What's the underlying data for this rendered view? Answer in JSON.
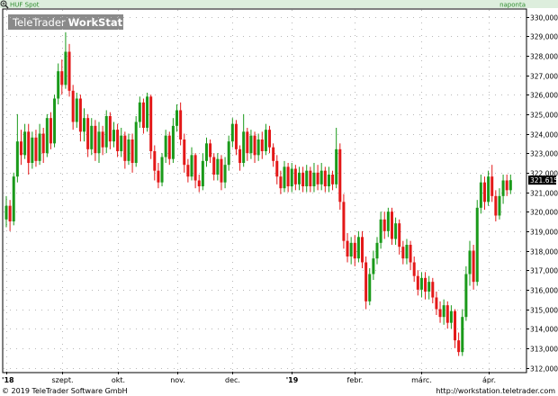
{
  "header": {
    "instrument": "HUF Spot",
    "period": "naponta",
    "watermark_prefix": "TeleTrader",
    "watermark_suffix": "WorkStation"
  },
  "footer": {
    "copyright": "© 2019 TeleTrader Software GmbH",
    "url": "http://workstation.teletrader.com"
  },
  "last_price_label": "321.6152",
  "colors": {
    "up": "#1a9a1a",
    "down": "#e31818",
    "grid": "#b9b9b9",
    "axis": "#000000",
    "bar_bg": "#ddeedd",
    "header_text": "#2e8b2e",
    "watermark_bg": "#8a8a8a"
  },
  "chart_data": {
    "type": "candlestick",
    "title": "HUF Spot",
    "interval": "naponta",
    "ylim": [
      312,
      330
    ],
    "ytick_values": [
      312,
      313,
      314,
      315,
      316,
      317,
      318,
      319,
      320,
      321,
      322,
      323,
      324,
      325,
      326,
      327,
      328,
      329,
      330
    ],
    "ytick_labels": [
      "312,000",
      "313,000",
      "314,000",
      "315,000",
      "316,000",
      "317,000",
      "318,000",
      "319,000",
      "320,000",
      "321,000",
      "322,000",
      "323,000",
      "324,000",
      "325,000",
      "326,000",
      "327,000",
      "328,000",
      "329,000",
      "330,000"
    ],
    "x_labels": [
      "'18",
      "szept.",
      "okt.",
      "nov.",
      "dec.",
      "'19",
      "febr.",
      "márc.",
      "ápr."
    ],
    "x_label_positions_day": [
      0,
      15,
      30,
      46,
      61,
      77,
      94,
      112,
      130
    ],
    "day_count": 139,
    "last_value": 321.6152,
    "grid": true,
    "candles": [
      {
        "x": 0,
        "o": 319.6,
        "c": 320.3,
        "h": 320.8,
        "l": 319.2
      },
      {
        "x": 1,
        "o": 320.3,
        "c": 319.5,
        "h": 320.6,
        "l": 319.0
      },
      {
        "x": 2,
        "o": 319.5,
        "c": 321.8,
        "h": 322.0,
        "l": 319.3
      },
      {
        "x": 3,
        "o": 321.8,
        "c": 323.6,
        "h": 325.0,
        "l": 321.5
      },
      {
        "x": 4,
        "o": 323.6,
        "c": 322.9,
        "h": 324.2,
        "l": 322.4
      },
      {
        "x": 5,
        "o": 322.9,
        "c": 324.1,
        "h": 324.5,
        "l": 322.7
      },
      {
        "x": 6,
        "o": 324.1,
        "c": 322.5,
        "h": 324.5,
        "l": 321.9
      },
      {
        "x": 7,
        "o": 322.5,
        "c": 323.8,
        "h": 324.1,
        "l": 322.2
      },
      {
        "x": 8,
        "o": 323.8,
        "c": 322.6,
        "h": 324.2,
        "l": 322.3
      },
      {
        "x": 9,
        "o": 322.6,
        "c": 324.0,
        "h": 324.5,
        "l": 322.4
      },
      {
        "x": 10,
        "o": 324.0,
        "c": 323.0,
        "h": 324.3,
        "l": 322.5
      },
      {
        "x": 11,
        "o": 323.0,
        "c": 324.8,
        "h": 325.0,
        "l": 322.8
      },
      {
        "x": 12,
        "o": 324.8,
        "c": 323.5,
        "h": 325.1,
        "l": 323.2
      },
      {
        "x": 13,
        "o": 323.5,
        "c": 325.8,
        "h": 326.0,
        "l": 323.3
      },
      {
        "x": 14,
        "o": 325.8,
        "c": 327.2,
        "h": 327.6,
        "l": 325.5
      },
      {
        "x": 15,
        "o": 327.2,
        "c": 326.5,
        "h": 327.8,
        "l": 326.0
      },
      {
        "x": 16,
        "o": 326.5,
        "c": 328.2,
        "h": 329.2,
        "l": 326.3
      },
      {
        "x": 17,
        "o": 328.2,
        "c": 326.2,
        "h": 328.6,
        "l": 325.9
      },
      {
        "x": 18,
        "o": 326.2,
        "c": 324.6,
        "h": 326.5,
        "l": 324.2
      },
      {
        "x": 19,
        "o": 324.6,
        "c": 325.8,
        "h": 326.1,
        "l": 324.3
      },
      {
        "x": 20,
        "o": 325.8,
        "c": 324.1,
        "h": 326.0,
        "l": 323.6
      },
      {
        "x": 21,
        "o": 324.1,
        "c": 324.8,
        "h": 325.3,
        "l": 323.6
      },
      {
        "x": 22,
        "o": 324.8,
        "c": 323.2,
        "h": 325.0,
        "l": 322.8
      },
      {
        "x": 23,
        "o": 323.2,
        "c": 324.4,
        "h": 324.8,
        "l": 322.9
      },
      {
        "x": 24,
        "o": 324.4,
        "c": 323.0,
        "h": 324.7,
        "l": 322.6
      },
      {
        "x": 25,
        "o": 323.0,
        "c": 324.1,
        "h": 324.6,
        "l": 322.5
      },
      {
        "x": 26,
        "o": 324.1,
        "c": 323.3,
        "h": 324.4,
        "l": 322.9
      },
      {
        "x": 27,
        "o": 323.3,
        "c": 324.9,
        "h": 325.2,
        "l": 323.0
      },
      {
        "x": 28,
        "o": 324.9,
        "c": 323.6,
        "h": 325.1,
        "l": 323.2
      },
      {
        "x": 29,
        "o": 323.6,
        "c": 324.2,
        "h": 324.6,
        "l": 323.3
      },
      {
        "x": 30,
        "o": 324.2,
        "c": 323.1,
        "h": 324.5,
        "l": 322.8
      },
      {
        "x": 31,
        "o": 323.1,
        "c": 323.9,
        "h": 324.3,
        "l": 322.8
      },
      {
        "x": 32,
        "o": 323.9,
        "c": 322.6,
        "h": 324.1,
        "l": 322.2
      },
      {
        "x": 33,
        "o": 322.6,
        "c": 323.7,
        "h": 324.0,
        "l": 322.4
      },
      {
        "x": 34,
        "o": 323.7,
        "c": 322.5,
        "h": 324.0,
        "l": 322.0
      },
      {
        "x": 35,
        "o": 322.5,
        "c": 324.6,
        "h": 324.9,
        "l": 322.3
      },
      {
        "x": 36,
        "o": 324.6,
        "c": 325.6,
        "h": 325.9,
        "l": 324.3
      },
      {
        "x": 37,
        "o": 325.6,
        "c": 324.3,
        "h": 325.8,
        "l": 324.0
      },
      {
        "x": 38,
        "o": 324.3,
        "c": 325.9,
        "h": 326.1,
        "l": 324.1
      },
      {
        "x": 39,
        "o": 325.9,
        "c": 323.1,
        "h": 326.0,
        "l": 322.7
      },
      {
        "x": 40,
        "o": 323.1,
        "c": 322.1,
        "h": 323.4,
        "l": 321.6
      },
      {
        "x": 41,
        "o": 322.1,
        "c": 321.5,
        "h": 322.5,
        "l": 321.2
      },
      {
        "x": 42,
        "o": 321.5,
        "c": 322.8,
        "h": 323.0,
        "l": 321.3
      },
      {
        "x": 43,
        "o": 322.8,
        "c": 323.9,
        "h": 324.2,
        "l": 322.5
      },
      {
        "x": 44,
        "o": 323.9,
        "c": 322.7,
        "h": 324.1,
        "l": 322.4
      },
      {
        "x": 45,
        "o": 322.7,
        "c": 324.4,
        "h": 324.8,
        "l": 322.5
      },
      {
        "x": 46,
        "o": 324.4,
        "c": 325.2,
        "h": 325.5,
        "l": 324.1
      },
      {
        "x": 47,
        "o": 325.2,
        "c": 323.7,
        "h": 325.6,
        "l": 323.4
      },
      {
        "x": 48,
        "o": 323.7,
        "c": 322.4,
        "h": 324.0,
        "l": 322.0
      },
      {
        "x": 49,
        "o": 322.4,
        "c": 321.8,
        "h": 322.7,
        "l": 321.5
      },
      {
        "x": 50,
        "o": 321.8,
        "c": 322.9,
        "h": 323.3,
        "l": 321.6
      },
      {
        "x": 51,
        "o": 322.9,
        "c": 321.6,
        "h": 323.0,
        "l": 321.2
      },
      {
        "x": 52,
        "o": 321.6,
        "c": 321.3,
        "h": 321.9,
        "l": 321.0
      },
      {
        "x": 53,
        "o": 321.3,
        "c": 322.6,
        "h": 323.0,
        "l": 321.1
      },
      {
        "x": 54,
        "o": 322.6,
        "c": 323.5,
        "h": 323.8,
        "l": 322.3
      },
      {
        "x": 55,
        "o": 323.5,
        "c": 322.8,
        "h": 323.7,
        "l": 322.5
      },
      {
        "x": 56,
        "o": 322.8,
        "c": 321.9,
        "h": 323.0,
        "l": 321.6
      },
      {
        "x": 57,
        "o": 321.9,
        "c": 322.7,
        "h": 323.0,
        "l": 321.6
      },
      {
        "x": 58,
        "o": 322.7,
        "c": 321.5,
        "h": 322.9,
        "l": 321.1
      },
      {
        "x": 59,
        "o": 321.5,
        "c": 322.4,
        "h": 322.8,
        "l": 321.2
      },
      {
        "x": 60,
        "o": 322.4,
        "c": 323.6,
        "h": 323.9,
        "l": 322.1
      },
      {
        "x": 61,
        "o": 323.6,
        "c": 324.5,
        "h": 324.8,
        "l": 323.3
      },
      {
        "x": 62,
        "o": 324.5,
        "c": 323.2,
        "h": 324.7,
        "l": 322.9
      },
      {
        "x": 63,
        "o": 323.2,
        "c": 322.5,
        "h": 323.4,
        "l": 322.1
      },
      {
        "x": 64,
        "o": 322.5,
        "c": 324.1,
        "h": 325.0,
        "l": 322.3
      },
      {
        "x": 65,
        "o": 324.1,
        "c": 323.0,
        "h": 324.3,
        "l": 322.6
      },
      {
        "x": 66,
        "o": 323.0,
        "c": 323.9,
        "h": 324.2,
        "l": 322.7
      },
      {
        "x": 67,
        "o": 323.9,
        "c": 322.9,
        "h": 324.1,
        "l": 322.5
      },
      {
        "x": 68,
        "o": 322.9,
        "c": 323.7,
        "h": 324.0,
        "l": 322.6
      },
      {
        "x": 69,
        "o": 323.7,
        "c": 323.1,
        "h": 324.1,
        "l": 322.7
      },
      {
        "x": 70,
        "o": 323.1,
        "c": 324.2,
        "h": 324.5,
        "l": 322.9
      },
      {
        "x": 71,
        "o": 324.2,
        "c": 323.3,
        "h": 324.4,
        "l": 323.0
      },
      {
        "x": 72,
        "o": 323.3,
        "c": 322.6,
        "h": 323.5,
        "l": 322.3
      },
      {
        "x": 73,
        "o": 322.6,
        "c": 321.8,
        "h": 322.9,
        "l": 321.4
      },
      {
        "x": 74,
        "o": 321.8,
        "c": 321.2,
        "h": 322.1,
        "l": 320.9
      },
      {
        "x": 75,
        "o": 321.2,
        "c": 322.3,
        "h": 322.6,
        "l": 321.0
      },
      {
        "x": 76,
        "o": 322.3,
        "c": 321.3,
        "h": 322.5,
        "l": 321.0
      },
      {
        "x": 77,
        "o": 321.3,
        "c": 322.2,
        "h": 322.5,
        "l": 321.0
      },
      {
        "x": 78,
        "o": 322.2,
        "c": 321.4,
        "h": 322.4,
        "l": 321.1
      },
      {
        "x": 79,
        "o": 321.4,
        "c": 322.0,
        "h": 322.3,
        "l": 321.1
      },
      {
        "x": 80,
        "o": 322.0,
        "c": 321.3,
        "h": 322.3,
        "l": 321.0
      },
      {
        "x": 81,
        "o": 321.3,
        "c": 322.1,
        "h": 322.4,
        "l": 321.0
      },
      {
        "x": 82,
        "o": 322.1,
        "c": 321.3,
        "h": 322.3,
        "l": 321.0
      },
      {
        "x": 83,
        "o": 321.3,
        "c": 322.0,
        "h": 322.5,
        "l": 321.0
      },
      {
        "x": 84,
        "o": 322.0,
        "c": 321.4,
        "h": 322.4,
        "l": 321.1
      },
      {
        "x": 85,
        "o": 321.4,
        "c": 322.1,
        "h": 322.5,
        "l": 321.1
      },
      {
        "x": 86,
        "o": 322.1,
        "c": 321.3,
        "h": 322.3,
        "l": 321.0
      },
      {
        "x": 87,
        "o": 321.3,
        "c": 321.9,
        "h": 322.3,
        "l": 321.0
      },
      {
        "x": 88,
        "o": 321.9,
        "c": 321.4,
        "h": 322.1,
        "l": 321.1
      },
      {
        "x": 89,
        "o": 321.4,
        "c": 323.2,
        "h": 324.3,
        "l": 321.2
      },
      {
        "x": 90,
        "o": 323.2,
        "c": 320.5,
        "h": 323.5,
        "l": 320.1
      },
      {
        "x": 91,
        "o": 320.5,
        "c": 318.5,
        "h": 320.9,
        "l": 318.1
      },
      {
        "x": 92,
        "o": 318.5,
        "c": 317.7,
        "h": 318.9,
        "l": 317.4
      },
      {
        "x": 93,
        "o": 317.7,
        "c": 318.4,
        "h": 318.7,
        "l": 317.3
      },
      {
        "x": 94,
        "o": 318.4,
        "c": 317.6,
        "h": 318.8,
        "l": 317.2
      },
      {
        "x": 95,
        "o": 317.6,
        "c": 318.7,
        "h": 319.0,
        "l": 317.4
      },
      {
        "x": 96,
        "o": 318.7,
        "c": 317.4,
        "h": 319.0,
        "l": 317.1
      },
      {
        "x": 97,
        "o": 317.4,
        "c": 315.4,
        "h": 317.7,
        "l": 315.0
      },
      {
        "x": 98,
        "o": 315.4,
        "c": 316.8,
        "h": 317.1,
        "l": 315.2
      },
      {
        "x": 99,
        "o": 316.8,
        "c": 317.6,
        "h": 318.0,
        "l": 316.5
      },
      {
        "x": 100,
        "o": 317.6,
        "c": 318.4,
        "h": 318.7,
        "l": 317.3
      },
      {
        "x": 101,
        "o": 318.4,
        "c": 319.6,
        "h": 320.0,
        "l": 318.1
      },
      {
        "x": 102,
        "o": 319.6,
        "c": 319.0,
        "h": 320.0,
        "l": 318.6
      },
      {
        "x": 103,
        "o": 319.0,
        "c": 320.0,
        "h": 320.2,
        "l": 318.7
      },
      {
        "x": 104,
        "o": 320.0,
        "c": 318.6,
        "h": 320.2,
        "l": 318.3
      },
      {
        "x": 105,
        "o": 318.6,
        "c": 319.4,
        "h": 319.7,
        "l": 318.3
      },
      {
        "x": 106,
        "o": 319.4,
        "c": 318.2,
        "h": 319.6,
        "l": 317.8
      },
      {
        "x": 107,
        "o": 318.2,
        "c": 317.6,
        "h": 318.5,
        "l": 317.3
      },
      {
        "x": 108,
        "o": 317.6,
        "c": 318.3,
        "h": 318.6,
        "l": 317.3
      },
      {
        "x": 109,
        "o": 318.3,
        "c": 317.4,
        "h": 318.5,
        "l": 317.0
      },
      {
        "x": 110,
        "o": 317.4,
        "c": 316.7,
        "h": 317.7,
        "l": 316.4
      },
      {
        "x": 111,
        "o": 316.7,
        "c": 316.0,
        "h": 317.0,
        "l": 315.7
      },
      {
        "x": 112,
        "o": 316.0,
        "c": 316.6,
        "h": 316.9,
        "l": 315.6
      },
      {
        "x": 113,
        "o": 316.6,
        "c": 315.9,
        "h": 316.9,
        "l": 315.5
      },
      {
        "x": 114,
        "o": 315.9,
        "c": 316.4,
        "h": 316.7,
        "l": 315.5
      },
      {
        "x": 115,
        "o": 316.4,
        "c": 315.6,
        "h": 316.6,
        "l": 315.3
      },
      {
        "x": 116,
        "o": 315.6,
        "c": 315.0,
        "h": 315.9,
        "l": 314.7
      },
      {
        "x": 117,
        "o": 315.0,
        "c": 314.6,
        "h": 315.4,
        "l": 314.3
      },
      {
        "x": 118,
        "o": 314.6,
        "c": 315.2,
        "h": 315.5,
        "l": 314.2
      },
      {
        "x": 119,
        "o": 315.2,
        "c": 314.3,
        "h": 315.4,
        "l": 314.0
      },
      {
        "x": 120,
        "o": 314.3,
        "c": 314.9,
        "h": 315.2,
        "l": 314.0
      },
      {
        "x": 121,
        "o": 314.9,
        "c": 313.4,
        "h": 315.0,
        "l": 313.0
      },
      {
        "x": 122,
        "o": 313.4,
        "c": 312.8,
        "h": 313.8,
        "l": 312.6
      },
      {
        "x": 123,
        "o": 312.8,
        "c": 314.6,
        "h": 315.0,
        "l": 312.6
      },
      {
        "x": 124,
        "o": 314.6,
        "c": 316.8,
        "h": 317.2,
        "l": 314.4
      },
      {
        "x": 125,
        "o": 316.8,
        "c": 318.0,
        "h": 318.5,
        "l": 316.2
      },
      {
        "x": 126,
        "o": 318.0,
        "c": 316.4,
        "h": 318.3,
        "l": 316.0
      },
      {
        "x": 127,
        "o": 316.4,
        "c": 320.2,
        "h": 320.6,
        "l": 316.2
      },
      {
        "x": 128,
        "o": 320.2,
        "c": 321.5,
        "h": 321.9,
        "l": 319.9
      },
      {
        "x": 129,
        "o": 321.5,
        "c": 320.5,
        "h": 321.8,
        "l": 320.1
      },
      {
        "x": 130,
        "o": 320.5,
        "c": 321.8,
        "h": 322.1,
        "l": 320.3
      },
      {
        "x": 131,
        "o": 321.8,
        "c": 320.8,
        "h": 322.4,
        "l": 320.5
      },
      {
        "x": 132,
        "o": 320.8,
        "c": 319.8,
        "h": 321.1,
        "l": 319.5
      },
      {
        "x": 133,
        "o": 319.8,
        "c": 320.8,
        "h": 321.2,
        "l": 319.6
      },
      {
        "x": 134,
        "o": 320.8,
        "c": 321.6,
        "h": 321.9,
        "l": 320.4
      },
      {
        "x": 135,
        "o": 321.6,
        "c": 321.1,
        "h": 321.9,
        "l": 320.8
      },
      {
        "x": 136,
        "o": 321.1,
        "c": 321.6152,
        "h": 321.9,
        "l": 320.9
      }
    ]
  }
}
